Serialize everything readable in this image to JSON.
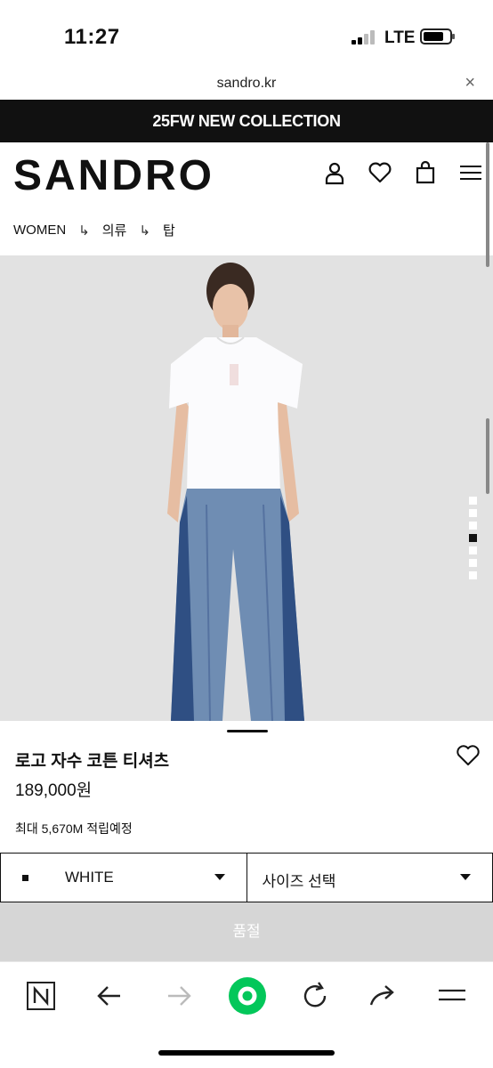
{
  "status_bar": {
    "time": "11:27",
    "network": "LTE"
  },
  "browser": {
    "url": "sandro.kr",
    "close_glyph": "×"
  },
  "promo": {
    "text": "25FW NEW COLLECTION"
  },
  "header": {
    "logo": "SANDRO",
    "icons": [
      "account-icon",
      "wishlist-heart-icon",
      "shopping-bag-icon",
      "menu-icon"
    ]
  },
  "breadcrumb": {
    "items": [
      "WOMEN",
      "의류",
      "탑"
    ],
    "separator": "↳"
  },
  "gallery": {
    "image_count": 7,
    "active_index": 3
  },
  "product": {
    "name": "로고 자수 코튼 티셔츠",
    "price": "189,000원",
    "points": "최대 5,670M 적립예정"
  },
  "color_select": {
    "value": "WHITE"
  },
  "size_select": {
    "placeholder": "사이즈 선택"
  },
  "soldout_button": {
    "label": "품절"
  },
  "toolbar": {
    "icons": [
      "naver-n-icon",
      "back-arrow-icon",
      "forward-arrow-icon",
      "green-home-icon",
      "reload-icon",
      "share-icon",
      "menu-lines-icon"
    ]
  },
  "colors": {
    "accent_green": "#03c75a",
    "banner": "#111111",
    "soldout": "#d6d6d6"
  }
}
